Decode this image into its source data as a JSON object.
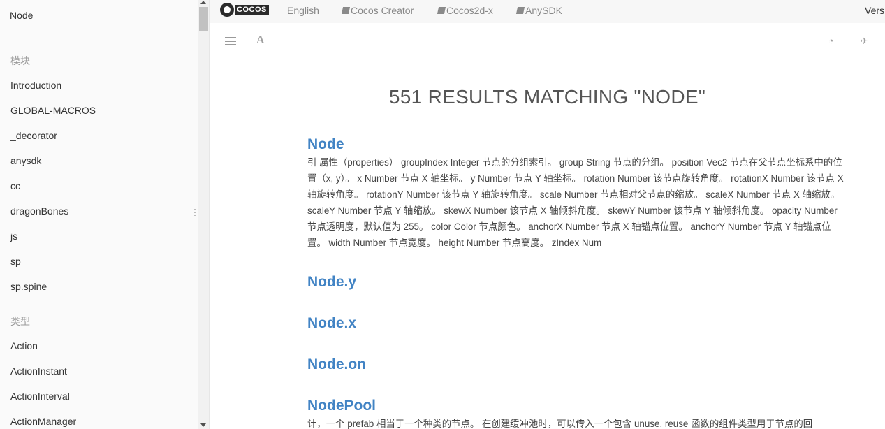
{
  "sidebar": {
    "search_value": "Node",
    "sections": [
      {
        "header": "模块",
        "items": [
          "Introduction",
          "GLOBAL-MACROS",
          "_decorator",
          "anysdk",
          "cc",
          "dragonBones",
          "js",
          "sp",
          "sp.spine"
        ]
      },
      {
        "header": "类型",
        "items": [
          "Action",
          "ActionInstant",
          "ActionInterval",
          "ActionManager"
        ]
      }
    ]
  },
  "topbar": {
    "logo_text": "COCOS",
    "links": [
      "English",
      "Cocos Creator",
      "Cocos2d-x",
      "AnySDK"
    ],
    "version_label": "Vers"
  },
  "toolbar": {
    "font_label": "A",
    "weibo_glyph": "◔",
    "twitter_glyph": "✈"
  },
  "results": {
    "heading": "551 RESULTS MATCHING \"NODE\"",
    "items": [
      {
        "title": "Node",
        "excerpt": "引 属性（properties） groupIndex Integer 节点的分组索引。 group String 节点的分组。 position Vec2 节点在父节点坐标系中的位置（x, y）。 x Number 节点 X 轴坐标。 y Number 节点 Y 轴坐标。 rotation Number 该节点旋转角度。 rotationX Number 该节点 X 轴旋转角度。 rotationY Number 该节点 Y 轴旋转角度。 scale Number 节点相对父节点的缩放。 scaleX Number 节点 X 轴缩放。 scaleY Number 节点 Y 轴缩放。 skewX Number 该节点 X 轴倾斜角度。 skewY Number 该节点 Y 轴倾斜角度。 opacity Number 节点透明度，默认值为 255。 color Color 节点颜色。 anchorX Number 节点 X 轴锚点位置。 anchorY Number 节点 Y 轴锚点位置。 width Number 节点宽度。 height Number 节点高度。 zIndex Num"
      },
      {
        "title": "Node.y",
        "excerpt": ""
      },
      {
        "title": "Node.x",
        "excerpt": ""
      },
      {
        "title": "Node.on",
        "excerpt": ""
      },
      {
        "title": "NodePool",
        "excerpt": "计，一个 prefab 相当于一个种类的节点。 在创建缓冲池时，可以传入一个包含 unuse, reuse 函数的组件类型用于节点的回"
      }
    ]
  }
}
